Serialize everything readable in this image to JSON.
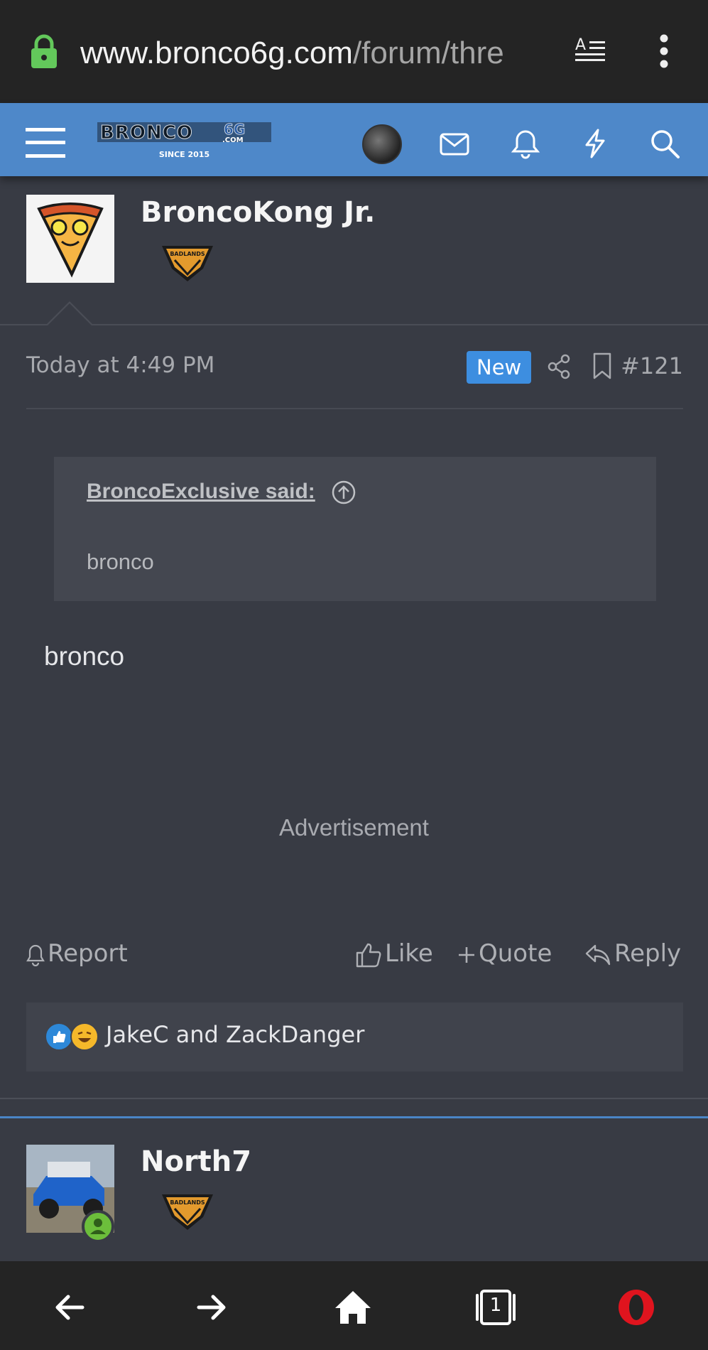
{
  "browser": {
    "url_domain": "www.bronco6g.com",
    "url_path": "/forum/thre"
  },
  "site": {
    "logo_text": "BRONCO6G.COM",
    "logo_since": "SINCE 2015"
  },
  "post1": {
    "username": "BroncoKong Jr.",
    "badge": "BADLANDS",
    "time": "Today at 4:49 PM",
    "new_label": "New",
    "post_number": "#121",
    "quote_author": "BroncoExclusive said:",
    "quote_text": "bronco",
    "body": "bronco",
    "advertisement": "Advertisement",
    "actions": {
      "report": "Report",
      "like": "Like",
      "quote": "Quote",
      "reply": "Reply"
    },
    "reactions_text": "JakeC and ZackDanger"
  },
  "post2": {
    "username": "North7",
    "badge": "BADLANDS"
  },
  "bottom_nav": {
    "tab_count": "1"
  },
  "colors": {
    "header_blue": "#4e88c9",
    "new_badge": "#3d8ee0",
    "online_green": "#6cbe3b",
    "opera_red": "#e0141e"
  }
}
